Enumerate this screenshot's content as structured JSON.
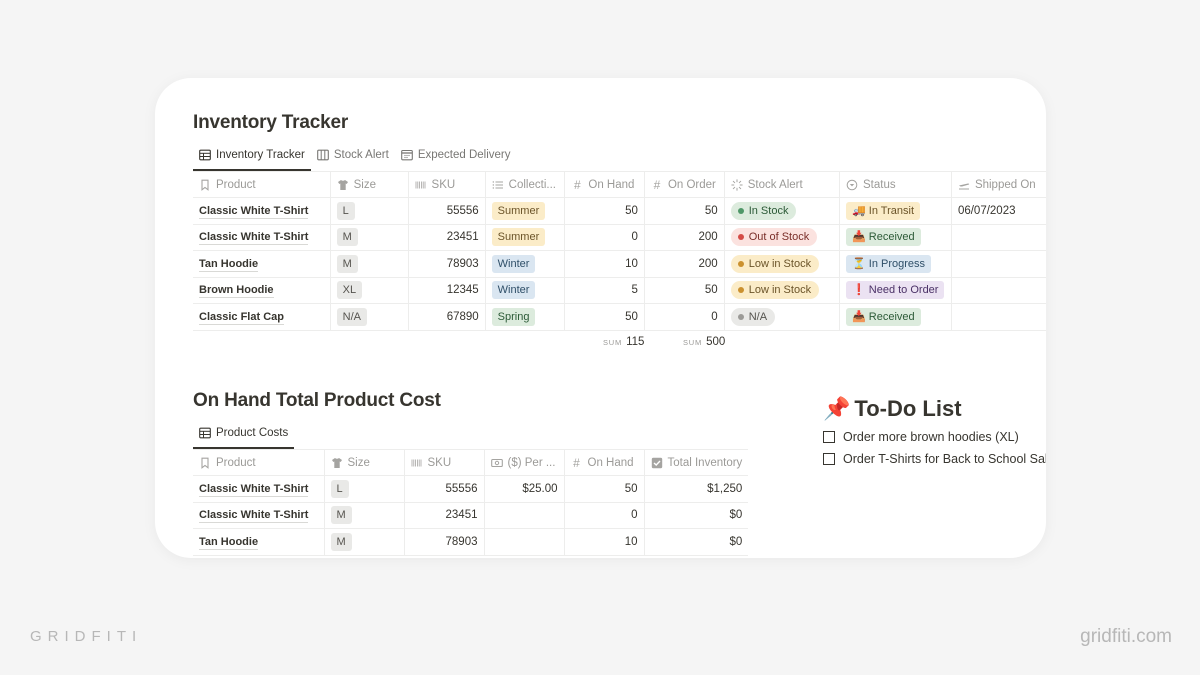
{
  "inventory": {
    "title": "Inventory Tracker",
    "tabs": [
      {
        "label": "Inventory Tracker",
        "icon": "table-icon",
        "active": true
      },
      {
        "label": "Stock Alert",
        "icon": "board-icon",
        "active": false
      },
      {
        "label": "Expected Delivery",
        "icon": "calendar-icon",
        "active": false
      }
    ],
    "columns": [
      {
        "label": "Product",
        "icon": "bookmark-icon"
      },
      {
        "label": "Size",
        "icon": "tshirt-icon"
      },
      {
        "label": "SKU",
        "icon": "barcode-icon"
      },
      {
        "label": "Collecti...",
        "icon": "list-icon"
      },
      {
        "label": "On Hand",
        "icon": "number-icon"
      },
      {
        "label": "On Order",
        "icon": "number-icon"
      },
      {
        "label": "Stock Alert",
        "icon": "loading-icon"
      },
      {
        "label": "Status",
        "icon": "status-icon"
      },
      {
        "label": "Shipped On",
        "icon": "plane-icon"
      }
    ],
    "rows": [
      {
        "product": "Classic White T-Shirt",
        "size": "L",
        "sku": "55556",
        "collection": "Summer",
        "collection_color": "yellow",
        "on_hand": "50",
        "on_order": "50",
        "stock_alert": "In Stock",
        "stock_alert_color": "green",
        "status": "In Transit",
        "status_icon": "🚚",
        "status_color": "yellow",
        "shipped_on": "06/07/2023"
      },
      {
        "product": "Classic White T-Shirt",
        "size": "M",
        "sku": "23451",
        "collection": "Summer",
        "collection_color": "yellow",
        "on_hand": "0",
        "on_order": "200",
        "stock_alert": "Out of Stock",
        "stock_alert_color": "red",
        "status": "Received",
        "status_icon": "📥",
        "status_color": "green",
        "shipped_on": ""
      },
      {
        "product": "Tan Hoodie",
        "size": "M",
        "sku": "78903",
        "collection": "Winter",
        "collection_color": "blue",
        "on_hand": "10",
        "on_order": "200",
        "stock_alert": "Low in Stock",
        "stock_alert_color": "yellow",
        "status": "In Progress",
        "status_icon": "⏳",
        "status_color": "blue",
        "shipped_on": ""
      },
      {
        "product": "Brown Hoodie",
        "size": "XL",
        "sku": "12345",
        "collection": "Winter",
        "collection_color": "blue",
        "on_hand": "5",
        "on_order": "50",
        "stock_alert": "Low in Stock",
        "stock_alert_color": "yellow",
        "status": "Need to Order",
        "status_icon": "❗",
        "status_color": "purple",
        "shipped_on": ""
      },
      {
        "product": "Classic Flat Cap",
        "size": "N/A",
        "sku": "67890",
        "collection": "Spring",
        "collection_color": "green",
        "on_hand": "50",
        "on_order": "0",
        "stock_alert": "N/A",
        "stock_alert_color": "gray",
        "status": "Received",
        "status_icon": "📥",
        "status_color": "green",
        "shipped_on": ""
      }
    ],
    "sums": {
      "label": "SUM",
      "on_hand": "115",
      "on_order": "500"
    }
  },
  "costs": {
    "title": "On Hand Total Product Cost",
    "tabs": [
      {
        "label": "Product Costs",
        "icon": "table-icon",
        "active": true
      }
    ],
    "columns": [
      {
        "label": "Product",
        "icon": "bookmark-icon"
      },
      {
        "label": "Size",
        "icon": "tshirt-icon"
      },
      {
        "label": "SKU",
        "icon": "barcode-icon"
      },
      {
        "label": "($) Per ...",
        "icon": "money-icon"
      },
      {
        "label": "On Hand",
        "icon": "number-icon"
      },
      {
        "label": "Total Inventory",
        "icon": "checkbox-icon"
      }
    ],
    "rows": [
      {
        "product": "Classic White T-Shirt",
        "size": "L",
        "sku": "55556",
        "per_unit": "$25.00",
        "on_hand": "50",
        "total": "$1,250"
      },
      {
        "product": "Classic White T-Shirt",
        "size": "M",
        "sku": "23451",
        "per_unit": "",
        "on_hand": "0",
        "total": "$0"
      },
      {
        "product": "Tan Hoodie",
        "size": "M",
        "sku": "78903",
        "per_unit": "",
        "on_hand": "10",
        "total": "$0"
      }
    ]
  },
  "todo": {
    "icon": "📌",
    "title": "To-Do List",
    "items": [
      {
        "label": "Order more brown hoodies (XL)",
        "checked": false
      },
      {
        "label": "Order T-Shirts for Back to School Sale",
        "checked": false
      }
    ]
  },
  "branding": {
    "left": "GRIDFITI",
    "right": "gridfiti.com"
  }
}
